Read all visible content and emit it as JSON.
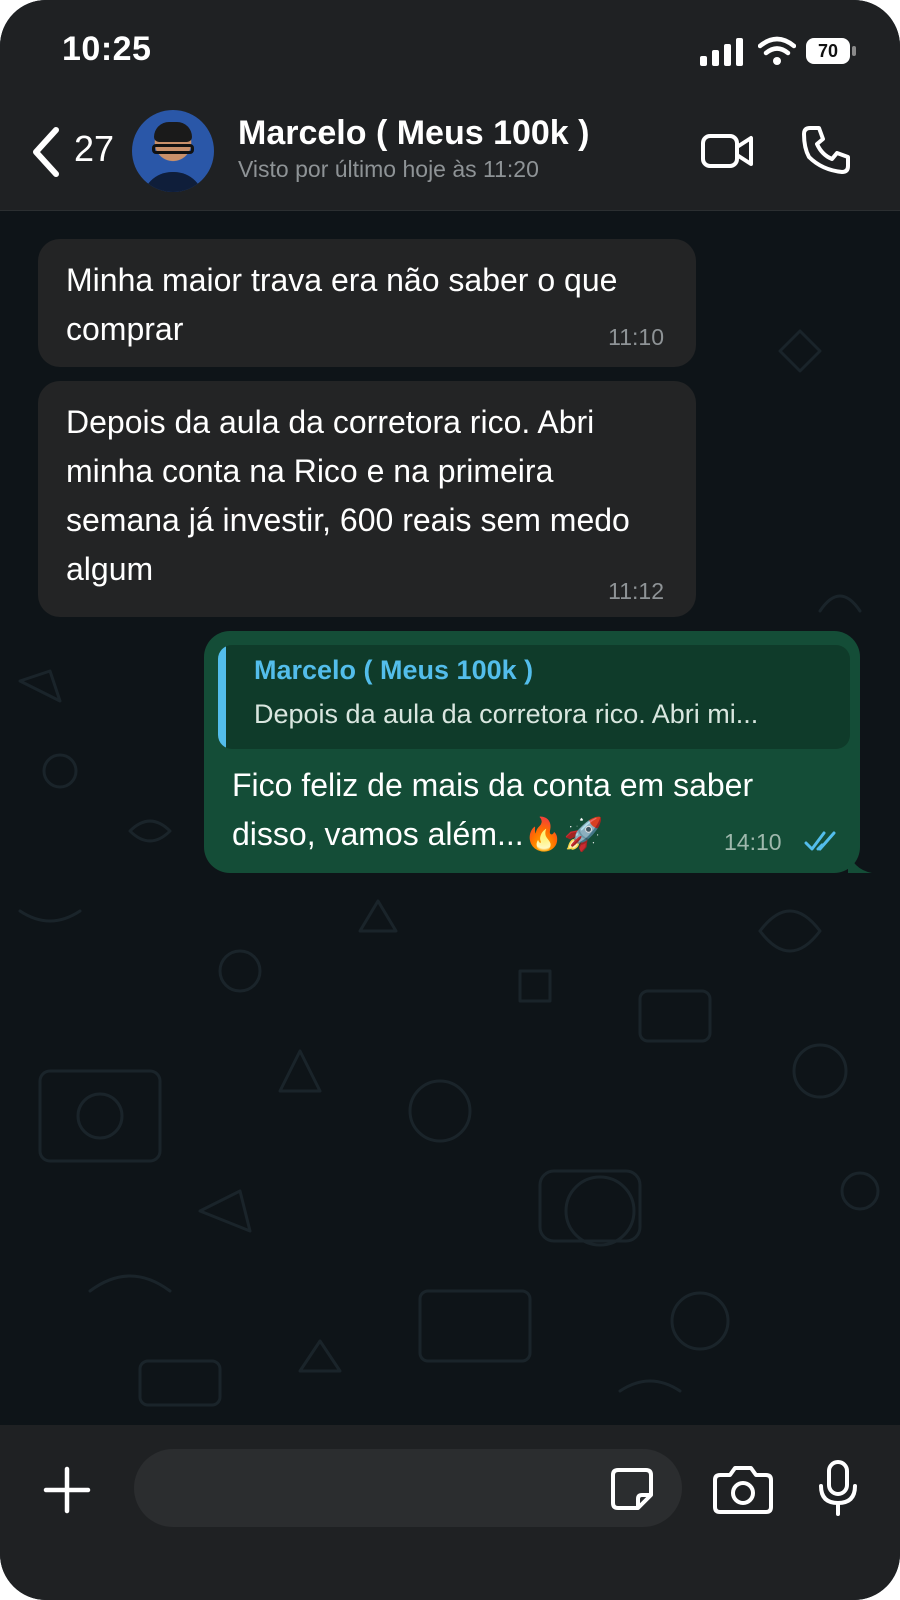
{
  "status_bar": {
    "time": "10:25",
    "battery": "70"
  },
  "header": {
    "back_count": "27",
    "contact_name": "Marcelo ( Meus 100k )",
    "last_seen": "Visto por último hoje às 11:20"
  },
  "messages": [
    {
      "direction": "incoming",
      "text": "Minha maior trava era não saber o que comprar",
      "time": "11:10"
    },
    {
      "direction": "incoming",
      "text": "Depois da aula da corretora rico. Abri minha conta na Rico e na primeira semana já investir, 600 reais sem medo algum",
      "time": "11:12"
    },
    {
      "direction": "outgoing",
      "quote": {
        "author": "Marcelo ( Meus 100k )",
        "text": "Depois da aula da corretora rico. Abri mi..."
      },
      "text": "Fico feliz de mais da conta em saber disso, vamos além...🔥🚀",
      "time": "14:10",
      "read": true
    }
  ],
  "input": {
    "placeholder": ""
  },
  "colors": {
    "accent_blue": "#53bdeb",
    "outgoing_bubble": "#144d37",
    "incoming_bubble": "#232425"
  }
}
